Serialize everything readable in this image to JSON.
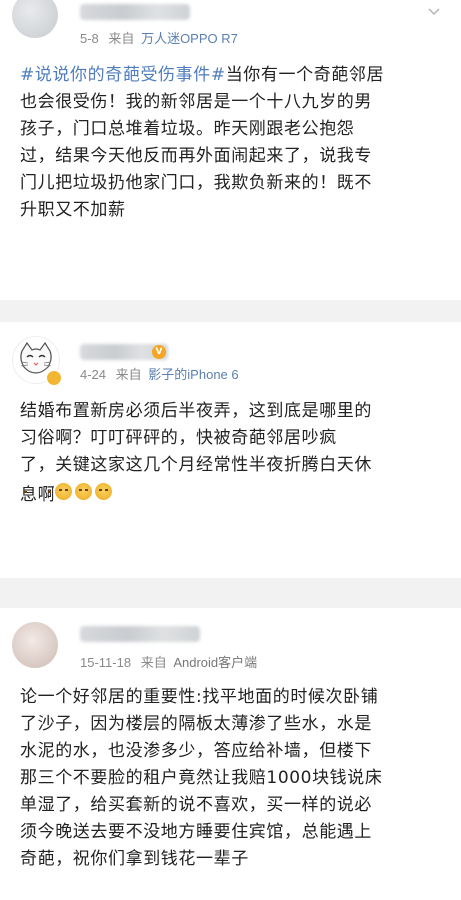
{
  "posts": [
    {
      "timestamp": "5-8",
      "source_prefix": "来自",
      "source": "万人迷OPPO R7",
      "lines": [
        {
          "hashtag": "#说说你的奇葩受伤事件#",
          "text": "当你有一个奇葩邻居"
        },
        {
          "text": "也会很受伤！我的新邻居是一个十八九岁的男"
        },
        {
          "text": "孩子，门口总堆着垃圾。昨天刚跟老公抱怨"
        },
        {
          "text": "过，结果今天他反而再外面闹起来了，说我专"
        },
        {
          "text": "门儿把垃圾扔他家门口，我欺负新来的！既不"
        },
        {
          "text": "升职又不加薪"
        }
      ]
    },
    {
      "timestamp": "4-24",
      "source_prefix": "来自",
      "source": "影子的iPhone 6",
      "vip_label": "V",
      "lines": [
        {
          "text": "结婚布置新房必须后半夜弄，这到底是哪里的"
        },
        {
          "text": "习俗啊？叮叮砰砰的，快被奇葩邻居吵疯"
        },
        {
          "text": "了，关键这家这几个月经常性半夜折腾白天休"
        },
        {
          "text": "息啊"
        }
      ],
      "emoji_count": 3,
      "emoji_name": "crying-face-emoji"
    },
    {
      "timestamp": "15-11-18",
      "source_prefix": "来自",
      "source": "Android客户端",
      "lines": [
        {
          "text": "论一个好邻居的重要性:找平地面的时候次卧铺"
        },
        {
          "text": "了沙子，因为楼层的隔板太薄渗了些水，水是"
        },
        {
          "text": "水泥的水，也没渗多少，答应给补墙，但楼下"
        },
        {
          "text": "那三个不要脸的租户竟然让我赔1000块钱说床"
        },
        {
          "text": "单湿了，给买套新的说不喜欢，买一样的说必"
        },
        {
          "text": "须今晚送去要不没地方睡要住宾馆，总能遇上"
        },
        {
          "text": "奇葩，祝你们拿到钱花一辈子"
        }
      ]
    }
  ],
  "colors": {
    "meta": "#8a8a8a",
    "source_link": "#5b7fb1",
    "hashtag": "#4f7dbf",
    "separator": "#f2f2f2"
  }
}
